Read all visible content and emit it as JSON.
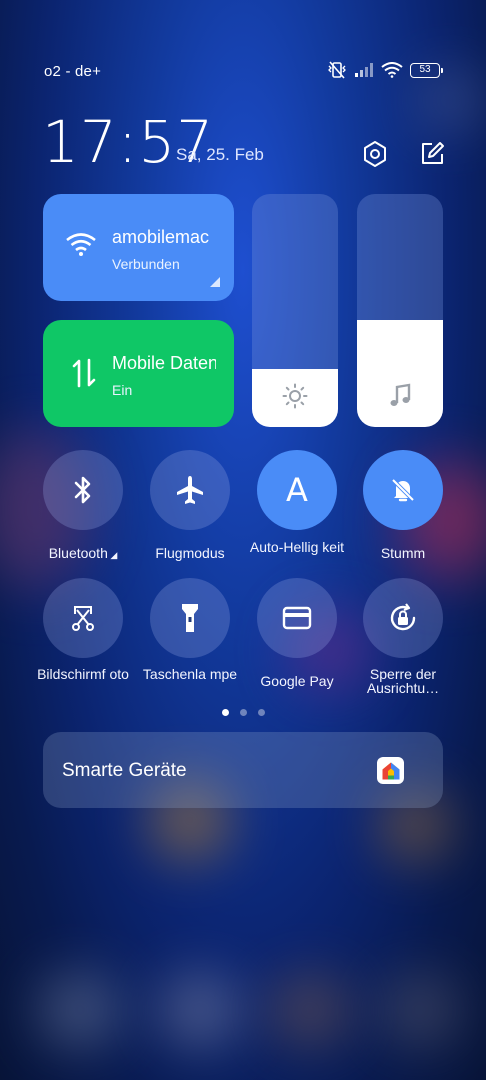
{
  "status_bar": {
    "carrier": "o2 - de+",
    "battery": "53",
    "icons": [
      "vibrate-off-icon",
      "signal-icon",
      "wifi-icon",
      "battery-icon"
    ]
  },
  "header": {
    "time": "17:57",
    "date": "Sa, 25. Feb",
    "icons": [
      "settings-icon",
      "edit-icon"
    ]
  },
  "tiles": {
    "wifi": {
      "title": "amobilemac",
      "subtitle": "Verbunden"
    },
    "mobile": {
      "title": "Mobile Daten",
      "subtitle": "Ein"
    }
  },
  "sliders": {
    "brightness": {
      "level": 0.25,
      "icon": "sun-icon"
    },
    "volume": {
      "level": 0.46,
      "icon": "music-note-icon"
    }
  },
  "toggles_row1": [
    {
      "name": "bluetooth",
      "label": "Bluetooth",
      "active": false,
      "icon": "bluetooth-icon"
    },
    {
      "name": "airplane",
      "label": "Flugmodus",
      "active": false,
      "icon": "airplane-icon"
    },
    {
      "name": "auto-brightness",
      "label": "Auto-Hellig keit",
      "active": true,
      "icon": "auto-a-icon"
    },
    {
      "name": "mute",
      "label": "Stumm",
      "active": true,
      "icon": "bell-off-icon"
    }
  ],
  "toggles_row2": [
    {
      "name": "screenshot",
      "label": "Bildschirmf oto",
      "active": false,
      "icon": "screenshot-scissors-icon"
    },
    {
      "name": "flashlight",
      "label": "Taschenla mpe",
      "active": false,
      "icon": "flashlight-icon"
    },
    {
      "name": "google-pay",
      "label": "Google Pay",
      "active": false,
      "icon": "card-icon"
    },
    {
      "name": "rotation-lock",
      "label": "Sperre der Ausrichtu…",
      "active": false,
      "icon": "rotation-lock-icon"
    }
  ],
  "pager": {
    "pages": 3,
    "current": 1
  },
  "smart_devices": {
    "label": "Smarte Geräte",
    "icon": "google-home-icon"
  },
  "colors": {
    "accent_blue": "#4a8cf7",
    "accent_green": "#0fc766"
  }
}
